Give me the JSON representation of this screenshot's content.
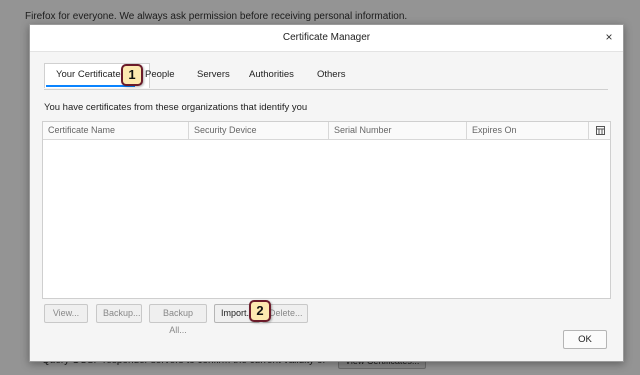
{
  "background": {
    "top_text": "Firefox for everyone. We always ask permission before receiving personal information.",
    "bottom_text": "Query OCSP responder servers to confirm the current validity of",
    "view_certs_button": "View Certificates..."
  },
  "dialog": {
    "title": "Certificate Manager",
    "close_glyph": "×",
    "tabs": [
      {
        "label": "Your Certificates"
      },
      {
        "label": "People"
      },
      {
        "label": "Servers"
      },
      {
        "label": "Authorities"
      },
      {
        "label": "Others"
      }
    ],
    "intro": "You have certificates from these organizations that identify you",
    "columns": [
      "Certificate Name",
      "Security Device",
      "Serial Number",
      "Expires On"
    ],
    "buttons": {
      "view": "View...",
      "backup": "Backup...",
      "backup_all": "Backup All...",
      "import": "Import...",
      "delete": "Delete..."
    },
    "ok": "OK"
  },
  "callouts": [
    "1",
    "2"
  ],
  "colors": {
    "accent": "#0a84ff",
    "callout_fill": "#fde9b0",
    "callout_border": "#6b1b2a"
  }
}
